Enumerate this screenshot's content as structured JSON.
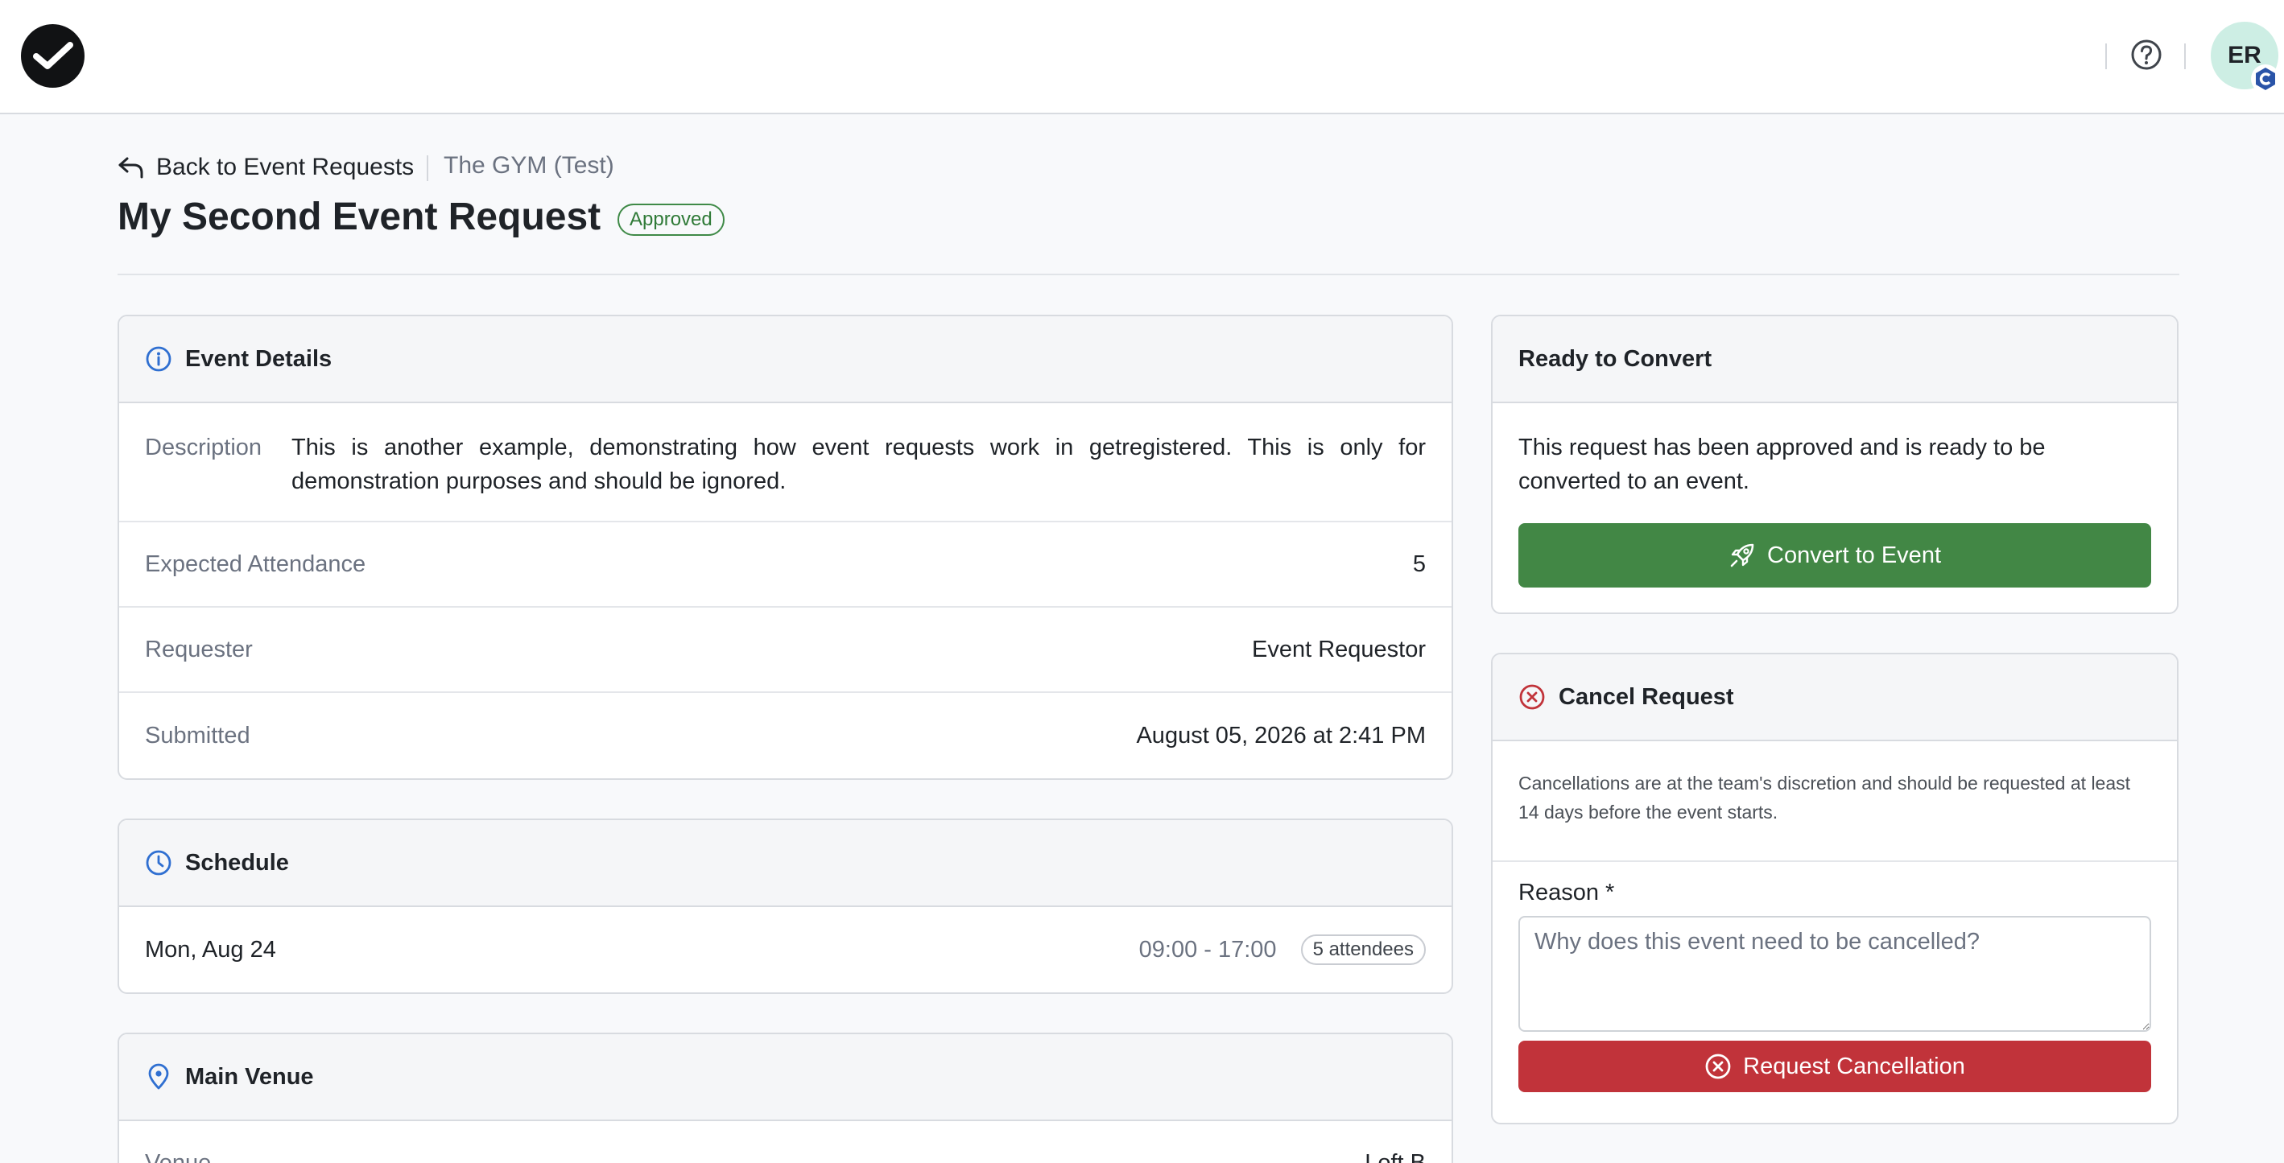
{
  "header": {
    "avatar_initials": "ER"
  },
  "breadcrumb": {
    "back_label": "Back to Event Requests",
    "organization": "The GYM (Test)"
  },
  "page": {
    "title": "My Second Event Request",
    "status": "Approved"
  },
  "event_details": {
    "title": "Event Details",
    "description_label": "Description",
    "description": "This is another example, demonstrating how event requests work in getregistered. This is only for demonstration purposes and should be ignored.",
    "attendance_label": "Expected Attendance",
    "attendance": "5",
    "requester_label": "Requester",
    "requester": "Event Requestor",
    "submitted_label": "Submitted",
    "submitted": "August 05, 2026 at 2:41 PM"
  },
  "schedule": {
    "title": "Schedule",
    "date": "Mon, Aug 24",
    "time": "09:00 - 17:00",
    "attendees": "5 attendees"
  },
  "venue": {
    "title": "Main Venue",
    "venue_label": "Venue",
    "venue_value": "Loft B"
  },
  "convert": {
    "title": "Ready to Convert",
    "message": "This request has been approved and is ready to be converted to an event.",
    "button_label": "Convert to Event"
  },
  "cancel": {
    "title": "Cancel Request",
    "note": "Cancellations are at the team's discretion and should be requested at least 14 days before the event starts.",
    "reason_label": "Reason *",
    "reason_placeholder": "Why does this event need to be cancelled?",
    "button_label": "Request Cancellation"
  },
  "colors": {
    "approved": "#3f8a47",
    "primary_green": "#428745",
    "danger_red": "#c1333a",
    "icon_blue": "#2f6fd1"
  }
}
